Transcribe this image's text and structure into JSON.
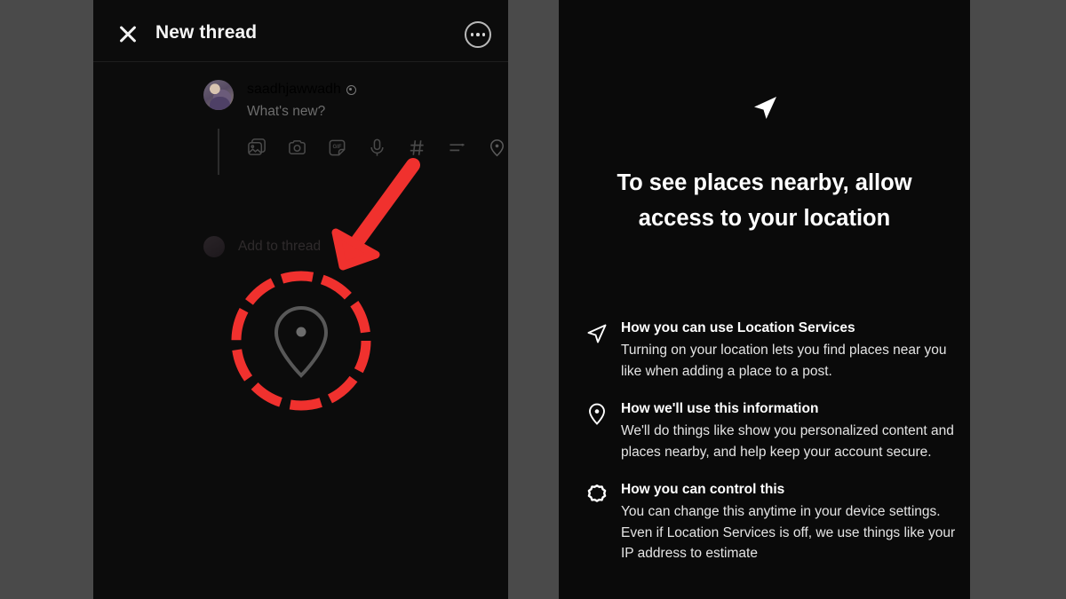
{
  "background_color": "#4a4a4a",
  "left_panel": {
    "header": {
      "close_label": "close",
      "title": "New thread",
      "more_label": "more options"
    },
    "composer": {
      "username": "saadhjawwadh",
      "placeholder": "What's new?",
      "add_to_thread_label": "Add to thread",
      "tools": [
        {
          "name": "gallery-icon",
          "label": "Add photo"
        },
        {
          "name": "camera-icon",
          "label": "Camera"
        },
        {
          "name": "gif-icon",
          "label": "GIF"
        },
        {
          "name": "microphone-icon",
          "label": "Voice"
        },
        {
          "name": "hashtag-icon",
          "label": "Tag topic"
        },
        {
          "name": "poll-icon",
          "label": "Poll"
        },
        {
          "name": "location-pin-icon",
          "label": "Add location"
        }
      ]
    },
    "annotation": {
      "highlight_color": "#f0312e",
      "target": "location-pin-icon"
    }
  },
  "right_panel": {
    "hero_icon": "navigation-arrow-icon",
    "title": "To see places nearby, allow access to your location",
    "items": [
      {
        "icon": "navigation-arrow-icon",
        "heading": "How you can use Location Services",
        "body": "Turning on your location lets you find places near you like when adding a place to a post."
      },
      {
        "icon": "location-pin-icon",
        "heading": "How we'll use this information",
        "body": "We'll do things like show you personalized content and places nearby, and help keep your account secure."
      },
      {
        "icon": "settings-gear-icon",
        "heading": "How you can control this",
        "body": "You can change this anytime in your device settings. Even if Location Services is off, we use things like your IP address to estimate"
      }
    ]
  }
}
